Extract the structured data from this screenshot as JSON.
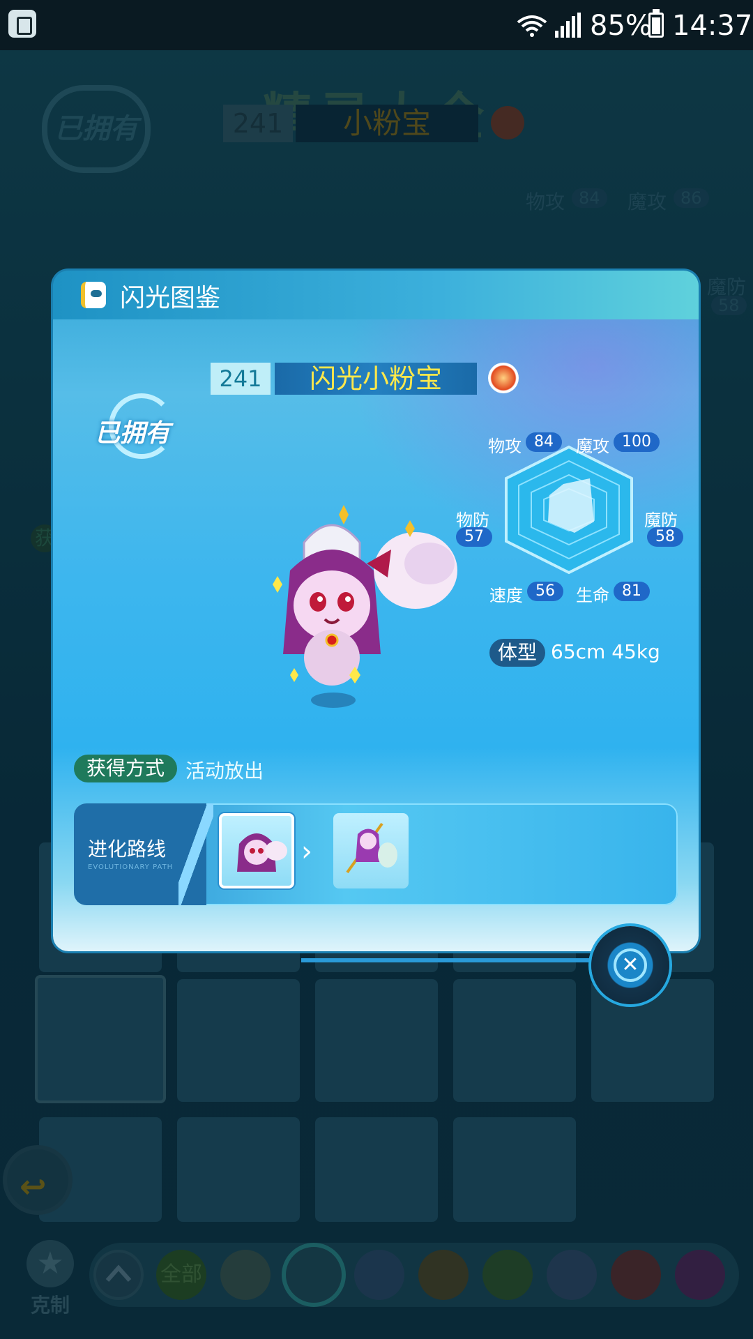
{
  "status_bar": {
    "battery": "85%",
    "time": "14:37"
  },
  "background": {
    "title": "精灵大全",
    "owned_label": "已拥有",
    "number": "241",
    "name": "小粉宝",
    "stats": {
      "phys_atk_label": "物攻",
      "phys_atk": "84",
      "mag_atk_label": "魔攻",
      "mag_atk": "86",
      "mag_def_label": "魔防",
      "mag_def": "58"
    },
    "obtain_label_partial": "获",
    "kezhi_label": "克制",
    "filter_all_label": "全部"
  },
  "modal": {
    "title": "闪光图鉴",
    "number": "241",
    "name": "闪光小粉宝",
    "owned_label": "已拥有",
    "stats": {
      "phys_atk_label": "物攻",
      "phys_atk": "84",
      "mag_atk_label": "魔攻",
      "mag_atk": "100",
      "phys_def_label": "物防",
      "phys_def": "57",
      "mag_def_label": "魔防",
      "mag_def": "58",
      "speed_label": "速度",
      "speed": "56",
      "hp_label": "生命",
      "hp": "81"
    },
    "body_label": "体型",
    "body_value": "65cm   45kg",
    "obtain_label": "获得方式",
    "obtain_value": "活动放出",
    "evolution_label": "进化路线",
    "evolution_sublabel": "EVOLUTIONARY PATH"
  },
  "colors": {
    "accent": "#2fb2ef",
    "name_text": "#ffe84a",
    "stat_pill": "#1f68c8"
  }
}
